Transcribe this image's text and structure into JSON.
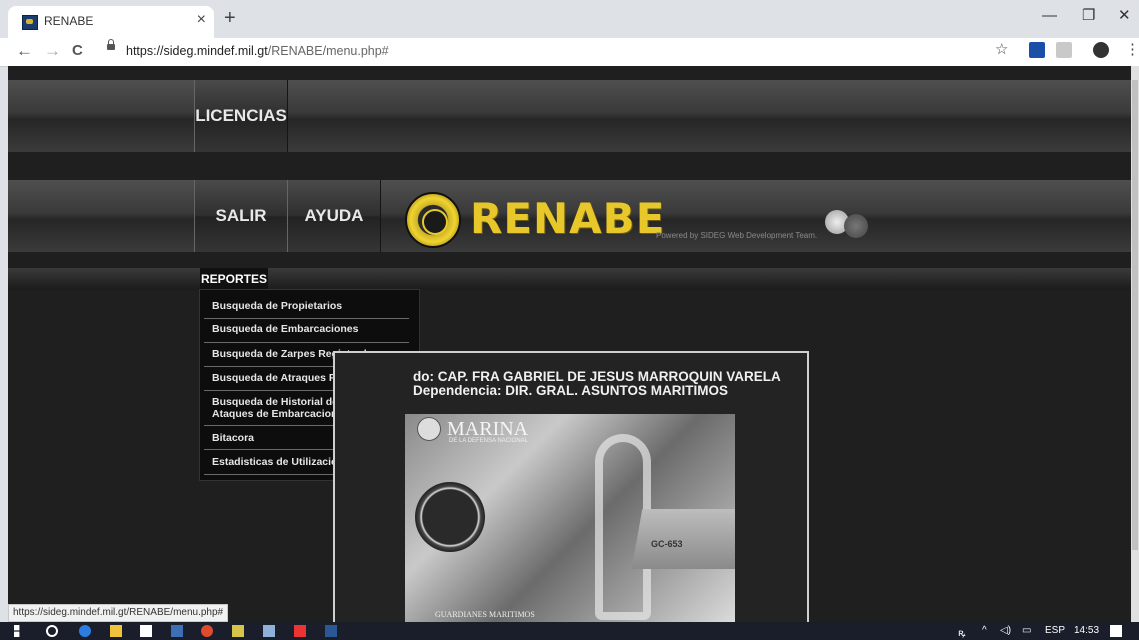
{
  "browser": {
    "tab_title": "RENABE",
    "tab_close": "×",
    "new_tab": "+",
    "url_host": "https://sideg.mindef.mil.gt",
    "url_path": "/RENABE/menu.php#",
    "window_minimize": "—",
    "window_restore": "❐",
    "window_close": "✕",
    "back": "←",
    "forward": "→",
    "reload": "C"
  },
  "site": {
    "nav_top": [
      "LICENCIAS"
    ],
    "nav_main": [
      "SALIR",
      "AYUDA"
    ],
    "logo_text": "RENABE",
    "powered_by": "Powered by SIDEG Web Development Team.",
    "reportes_label": "REPORTES",
    "dropdown_items": [
      "Busqueda de Propietarios",
      "Busqueda de Embarcaciones",
      "Busqueda de Zarpes Registrados",
      "Busqueda de Atraques Registrados",
      "Busqueda de Historial de Zarpes y Ataques de Embarcaciones",
      "Bitacora",
      "Estadisticas de Utilización"
    ],
    "welcome_line1": "do: CAP. FRA GABRIEL DE JESUS MARROQUIN VARELA",
    "welcome_line2": "Dependencia: DIR. GRAL. ASUNTOS MARITIMOS",
    "photo_marina": "MARINA",
    "photo_marina_sub": "DE LA DEFENSA NACIONAL",
    "photo_ship_number": "GC-653",
    "photo_caption": "GUARDIANES MARITIMOS"
  },
  "status_url": "https://sideg.mindef.mil.gt/RENABE/menu.php#",
  "taskbar": {
    "language": "ESP",
    "time": "14:53"
  }
}
